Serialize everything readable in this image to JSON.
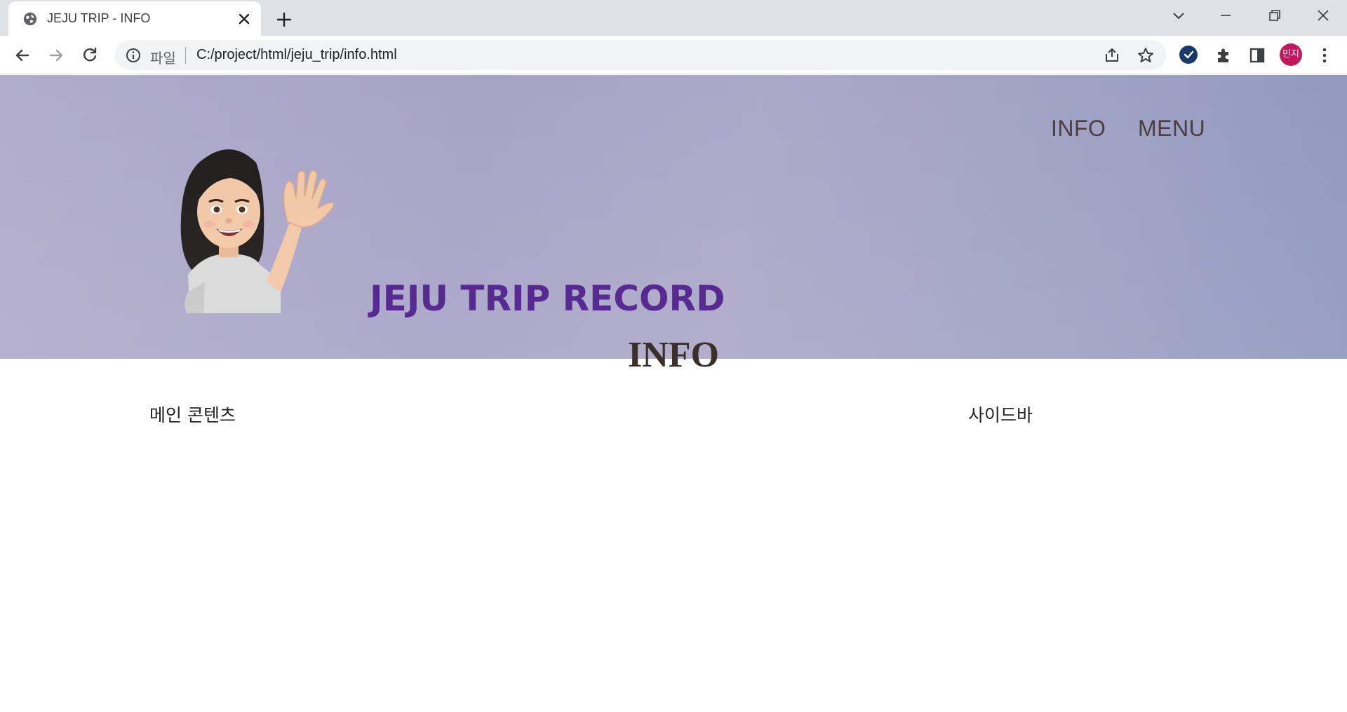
{
  "browser": {
    "tab_title": "JEJU TRIP - INFO",
    "address_label": "파일",
    "url": "C:/project/html/jeju_trip/info.html",
    "profile_initials": "민지"
  },
  "nav": {
    "items": [
      {
        "label": "INFO"
      },
      {
        "label": "MENU"
      }
    ]
  },
  "header": {
    "site_title": "JEJU TRIP RECORD"
  },
  "main": {
    "section_title": "INFO",
    "content_label": "메인 콘텐츠",
    "sidebar_label": "사이드바"
  },
  "colors": {
    "title_purple": "#4c1c8a",
    "nav_text": "#4a3a3a",
    "hero_bg": "#aaa6c8"
  }
}
